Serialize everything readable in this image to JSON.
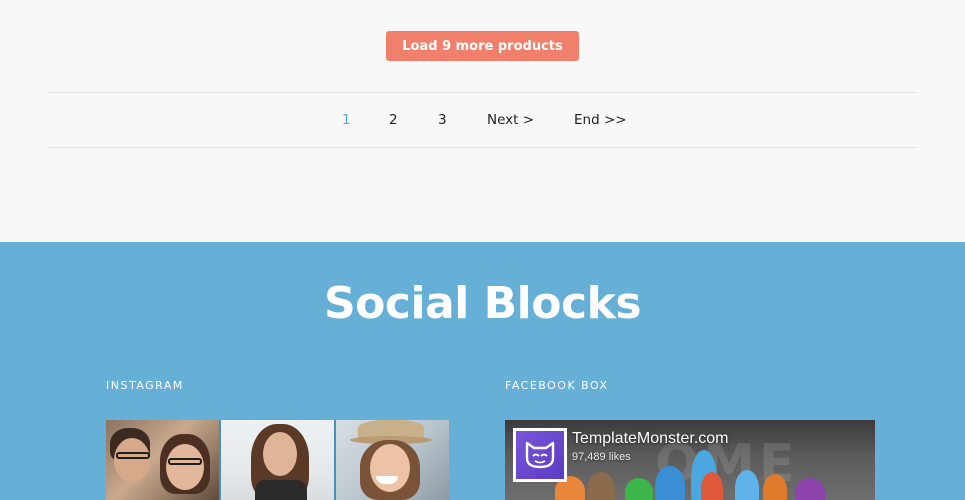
{
  "load_more": {
    "label": "Load 9 more products"
  },
  "pagination": {
    "pages": [
      "1",
      "2",
      "3"
    ],
    "active_page": "1",
    "next_label": "Next >",
    "end_label": "End >>"
  },
  "social": {
    "title": "Social Blocks",
    "instagram": {
      "label": "INSTAGRAM"
    },
    "facebook": {
      "label": "FACEBOOK BOX",
      "page_name": "TemplateMonster.com",
      "likes": "97,489 likes"
    }
  },
  "colors": {
    "accent_button": "#f07f6b",
    "social_bg": "#66afd6",
    "active_page": "#5ba7d2",
    "page_bg": "#f8f8f8"
  }
}
